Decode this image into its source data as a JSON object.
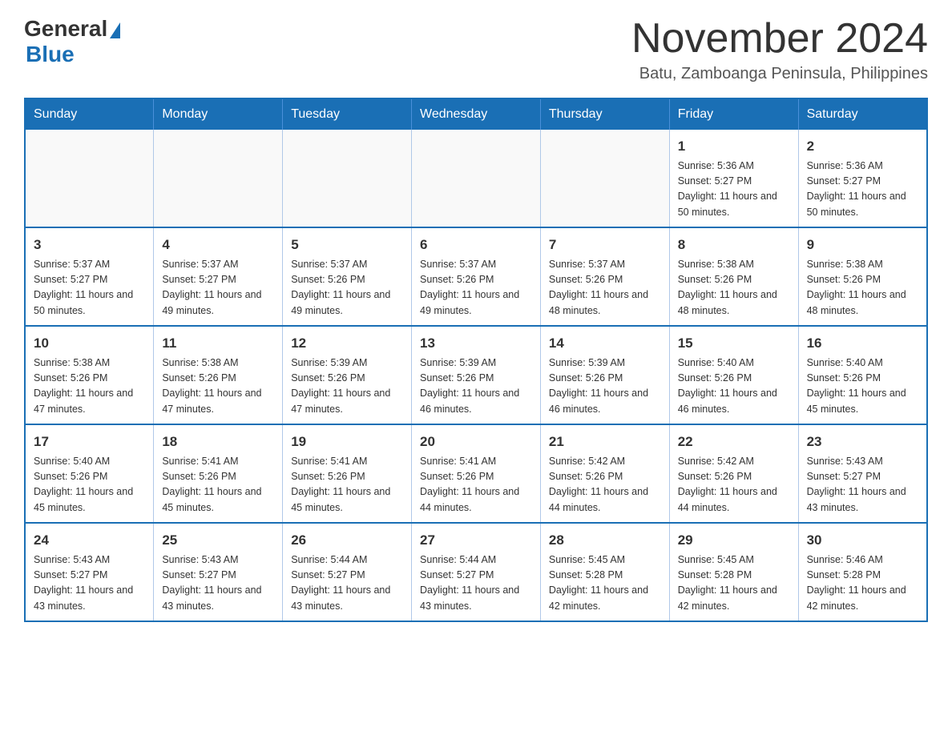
{
  "logo": {
    "text_general": "General",
    "text_blue": "Blue"
  },
  "title": "November 2024",
  "subtitle": "Batu, Zamboanga Peninsula, Philippines",
  "weekdays": [
    "Sunday",
    "Monday",
    "Tuesday",
    "Wednesday",
    "Thursday",
    "Friday",
    "Saturday"
  ],
  "weeks": [
    [
      {
        "day": "",
        "info": ""
      },
      {
        "day": "",
        "info": ""
      },
      {
        "day": "",
        "info": ""
      },
      {
        "day": "",
        "info": ""
      },
      {
        "day": "",
        "info": ""
      },
      {
        "day": "1",
        "info": "Sunrise: 5:36 AM\nSunset: 5:27 PM\nDaylight: 11 hours and 50 minutes."
      },
      {
        "day": "2",
        "info": "Sunrise: 5:36 AM\nSunset: 5:27 PM\nDaylight: 11 hours and 50 minutes."
      }
    ],
    [
      {
        "day": "3",
        "info": "Sunrise: 5:37 AM\nSunset: 5:27 PM\nDaylight: 11 hours and 50 minutes."
      },
      {
        "day": "4",
        "info": "Sunrise: 5:37 AM\nSunset: 5:27 PM\nDaylight: 11 hours and 49 minutes."
      },
      {
        "day": "5",
        "info": "Sunrise: 5:37 AM\nSunset: 5:26 PM\nDaylight: 11 hours and 49 minutes."
      },
      {
        "day": "6",
        "info": "Sunrise: 5:37 AM\nSunset: 5:26 PM\nDaylight: 11 hours and 49 minutes."
      },
      {
        "day": "7",
        "info": "Sunrise: 5:37 AM\nSunset: 5:26 PM\nDaylight: 11 hours and 48 minutes."
      },
      {
        "day": "8",
        "info": "Sunrise: 5:38 AM\nSunset: 5:26 PM\nDaylight: 11 hours and 48 minutes."
      },
      {
        "day": "9",
        "info": "Sunrise: 5:38 AM\nSunset: 5:26 PM\nDaylight: 11 hours and 48 minutes."
      }
    ],
    [
      {
        "day": "10",
        "info": "Sunrise: 5:38 AM\nSunset: 5:26 PM\nDaylight: 11 hours and 47 minutes."
      },
      {
        "day": "11",
        "info": "Sunrise: 5:38 AM\nSunset: 5:26 PM\nDaylight: 11 hours and 47 minutes."
      },
      {
        "day": "12",
        "info": "Sunrise: 5:39 AM\nSunset: 5:26 PM\nDaylight: 11 hours and 47 minutes."
      },
      {
        "day": "13",
        "info": "Sunrise: 5:39 AM\nSunset: 5:26 PM\nDaylight: 11 hours and 46 minutes."
      },
      {
        "day": "14",
        "info": "Sunrise: 5:39 AM\nSunset: 5:26 PM\nDaylight: 11 hours and 46 minutes."
      },
      {
        "day": "15",
        "info": "Sunrise: 5:40 AM\nSunset: 5:26 PM\nDaylight: 11 hours and 46 minutes."
      },
      {
        "day": "16",
        "info": "Sunrise: 5:40 AM\nSunset: 5:26 PM\nDaylight: 11 hours and 45 minutes."
      }
    ],
    [
      {
        "day": "17",
        "info": "Sunrise: 5:40 AM\nSunset: 5:26 PM\nDaylight: 11 hours and 45 minutes."
      },
      {
        "day": "18",
        "info": "Sunrise: 5:41 AM\nSunset: 5:26 PM\nDaylight: 11 hours and 45 minutes."
      },
      {
        "day": "19",
        "info": "Sunrise: 5:41 AM\nSunset: 5:26 PM\nDaylight: 11 hours and 45 minutes."
      },
      {
        "day": "20",
        "info": "Sunrise: 5:41 AM\nSunset: 5:26 PM\nDaylight: 11 hours and 44 minutes."
      },
      {
        "day": "21",
        "info": "Sunrise: 5:42 AM\nSunset: 5:26 PM\nDaylight: 11 hours and 44 minutes."
      },
      {
        "day": "22",
        "info": "Sunrise: 5:42 AM\nSunset: 5:26 PM\nDaylight: 11 hours and 44 minutes."
      },
      {
        "day": "23",
        "info": "Sunrise: 5:43 AM\nSunset: 5:27 PM\nDaylight: 11 hours and 43 minutes."
      }
    ],
    [
      {
        "day": "24",
        "info": "Sunrise: 5:43 AM\nSunset: 5:27 PM\nDaylight: 11 hours and 43 minutes."
      },
      {
        "day": "25",
        "info": "Sunrise: 5:43 AM\nSunset: 5:27 PM\nDaylight: 11 hours and 43 minutes."
      },
      {
        "day": "26",
        "info": "Sunrise: 5:44 AM\nSunset: 5:27 PM\nDaylight: 11 hours and 43 minutes."
      },
      {
        "day": "27",
        "info": "Sunrise: 5:44 AM\nSunset: 5:27 PM\nDaylight: 11 hours and 43 minutes."
      },
      {
        "day": "28",
        "info": "Sunrise: 5:45 AM\nSunset: 5:28 PM\nDaylight: 11 hours and 42 minutes."
      },
      {
        "day": "29",
        "info": "Sunrise: 5:45 AM\nSunset: 5:28 PM\nDaylight: 11 hours and 42 minutes."
      },
      {
        "day": "30",
        "info": "Sunrise: 5:46 AM\nSunset: 5:28 PM\nDaylight: 11 hours and 42 minutes."
      }
    ]
  ]
}
